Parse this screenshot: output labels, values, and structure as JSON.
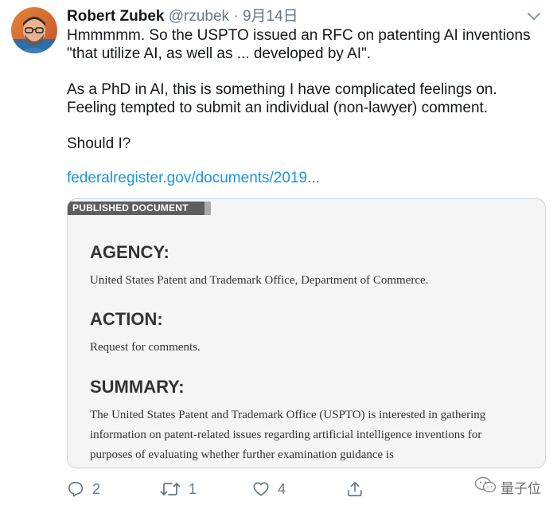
{
  "tweet": {
    "author_name": "Robert Zubek",
    "author_handle": "@rzubek",
    "separator": "·",
    "date": "9月14日",
    "paragraphs": [
      "Hmmmmm. So the USPTO issued an RFC on patenting AI inventions \"that utilize AI, as well as ... developed by AI\".",
      "As a PhD in AI, this is something I have complicated feelings on. Feeling tempted to submit an individual (non-lawyer) comment.",
      "Should I?"
    ],
    "link": "federalregister.gov/documents/2019..."
  },
  "card": {
    "tag": "PUBLISHED DOCUMENT",
    "sections": [
      {
        "heading": "AGENCY:",
        "body": "United States Patent and Trademark Office, Department of Commerce."
      },
      {
        "heading": "ACTION:",
        "body": "Request for comments."
      },
      {
        "heading": "SUMMARY:",
        "body": "The United States Patent and Trademark Office (USPTO) is interested in gathering information on patent-related issues regarding artificial intelligence inventions for purposes of evaluating whether further examination guidance is"
      }
    ]
  },
  "actions": {
    "reply_count": "2",
    "retweet_count": "1",
    "like_count": "4"
  },
  "watermark": {
    "text": "量子位"
  },
  "colors": {
    "link": "#1b95e0",
    "secondary": "#657786",
    "card_bg": "#f5f5f5"
  }
}
